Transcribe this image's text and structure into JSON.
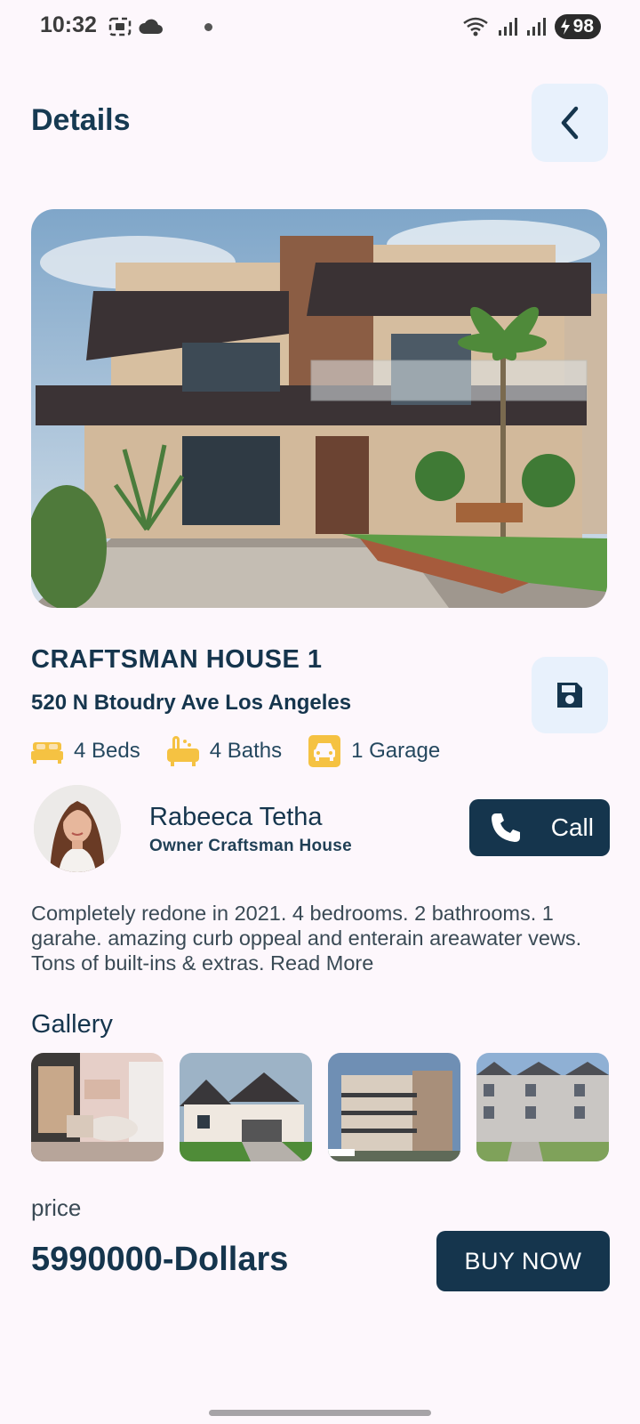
{
  "status_bar": {
    "time": "10:32",
    "battery": "98",
    "icons_left": [
      "screenshot-icon",
      "cloud-icon",
      "dot-icon"
    ],
    "icons_right": [
      "wifi-icon",
      "signal-icon",
      "signal-icon-2",
      "battery-icon"
    ]
  },
  "header": {
    "title": "Details",
    "back_icon": "chevron-left-icon"
  },
  "property": {
    "name": "CRAFTSMAN HOUSE 1",
    "address": "520 N Btoudry Ave Los Angeles",
    "save_icon": "floppy-disk-icon",
    "features": [
      {
        "icon": "bed-icon",
        "label": "4 Beds"
      },
      {
        "icon": "bath-icon",
        "label": "4 Baths"
      },
      {
        "icon": "car-icon",
        "label": "1 Garage"
      }
    ],
    "description": "Completely redone in 2021. 4 bedrooms. 2 bathrooms. 1 garahe. amazing curb oppeal and enterain areawater vews. Tons of built-ins & extras. Read More"
  },
  "owner": {
    "name": "Rabeeca Tetha",
    "role": "Owner Craftsman House",
    "call_label": "Call"
  },
  "gallery": {
    "title": "Gallery",
    "items": [
      "living-room-photo",
      "suburban-house-photo",
      "apartment-building-photo",
      "townhouses-photo"
    ]
  },
  "pricing": {
    "label": "price",
    "value": "5990000-Dollars",
    "buy_label": "BUY NOW"
  },
  "colors": {
    "background": "#fdf7fc",
    "primary": "#15354d",
    "accent_yellow": "#f5c242",
    "button_light": "#e8f1fc"
  }
}
